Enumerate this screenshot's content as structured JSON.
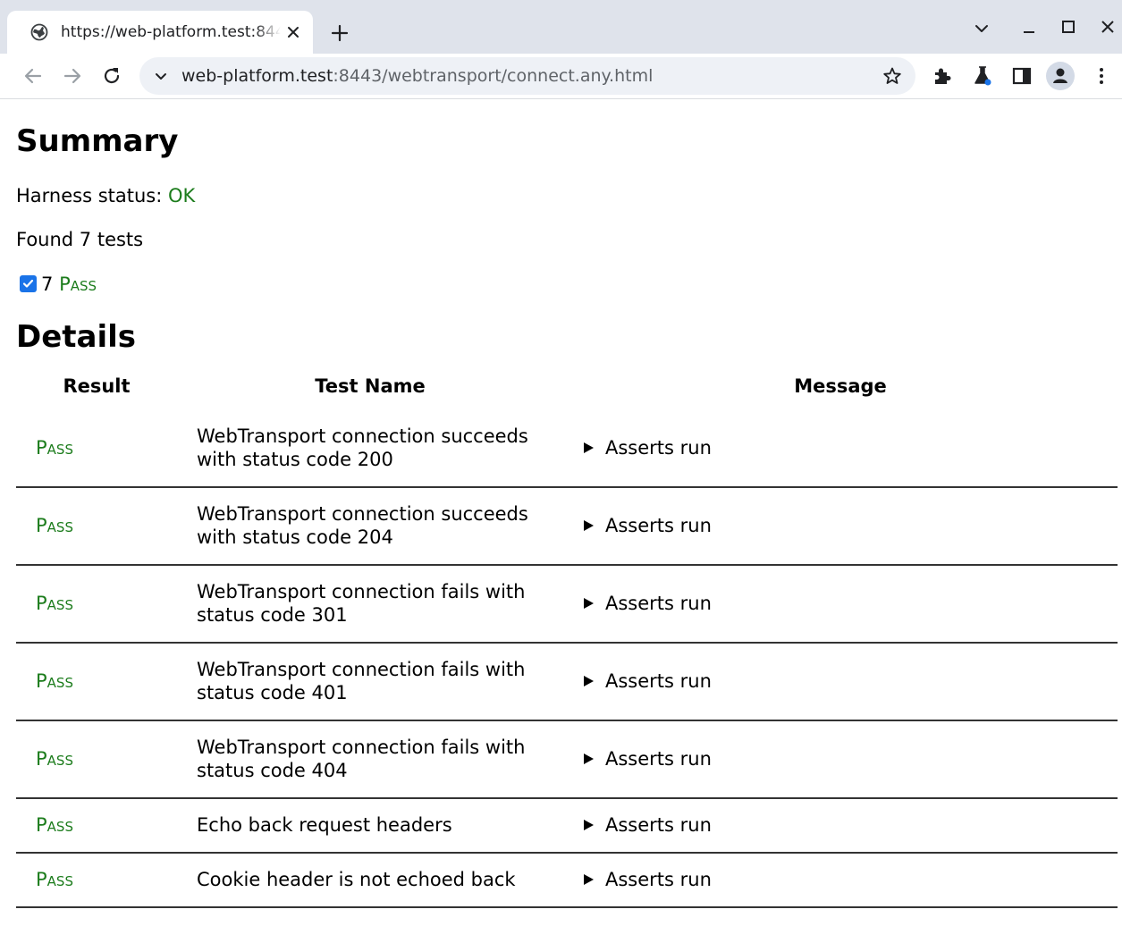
{
  "browser": {
    "tab_title": "https://web-platform.test:8443/webtransport/connect.any.html",
    "url_host": "web-platform.test",
    "url_rest": ":8443/webtransport/connect.any.html"
  },
  "summary": {
    "heading": "Summary",
    "harness_label": "Harness status: ",
    "harness_status": "OK",
    "found_text": "Found 7 tests",
    "pass_count": "7",
    "pass_label": "Pass",
    "pass_checked": true
  },
  "details": {
    "heading": "Details",
    "columns": [
      "Result",
      "Test Name",
      "Message"
    ],
    "rows": [
      {
        "result": "Pass",
        "name": "WebTransport connection succeeds with status code 200",
        "message": "Asserts run"
      },
      {
        "result": "Pass",
        "name": "WebTransport connection succeeds with status code 204",
        "message": "Asserts run"
      },
      {
        "result": "Pass",
        "name": "WebTransport connection fails with status code 301",
        "message": "Asserts run"
      },
      {
        "result": "Pass",
        "name": "WebTransport connection fails with status code 401",
        "message": "Asserts run"
      },
      {
        "result": "Pass",
        "name": "WebTransport connection fails with status code 404",
        "message": "Asserts run"
      },
      {
        "result": "Pass",
        "name": "Echo back request headers",
        "message": "Asserts run"
      },
      {
        "result": "Pass",
        "name": "Cookie header is not echoed back",
        "message": "Asserts run"
      }
    ]
  },
  "colors": {
    "pass": "#1c7c1c",
    "accent": "#1a73e8"
  },
  "icons": [
    "globe-icon",
    "close-icon",
    "plus-icon",
    "chevron-down-icon",
    "minimize-icon",
    "maximize-icon",
    "back-arrow-icon",
    "forward-arrow-icon",
    "reload-icon",
    "star-icon",
    "extensions-icon",
    "labs-flask-icon",
    "side-panel-icon",
    "profile-icon",
    "kebab-menu-icon",
    "disclosure-triangle-icon"
  ]
}
